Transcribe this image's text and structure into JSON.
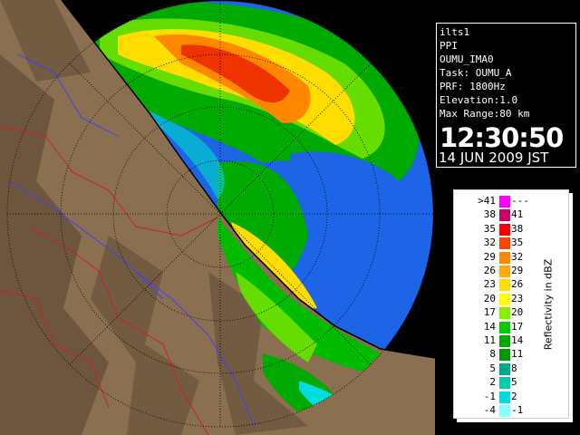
{
  "info": {
    "lines": [
      "ilts1",
      "PPI",
      "OUMU_IMA0",
      "Task: OUMU_A",
      "PRF: 1800Hz",
      "Elevation:1.0",
      "Max Range:80 km"
    ],
    "time": "12:30:50",
    "date": "14 JUN 2009 JST"
  },
  "legend": {
    "title": "Reflectivity in dBZ",
    "rows": [
      {
        "lo": ">41",
        "hi": "---",
        "color": "#ff00ff"
      },
      {
        "lo": "38",
        "hi": "41",
        "color": "#cc0066"
      },
      {
        "lo": "35",
        "hi": "38",
        "color": "#ff0000"
      },
      {
        "lo": "32",
        "hi": "35",
        "color": "#ff4400"
      },
      {
        "lo": "29",
        "hi": "32",
        "color": "#ff8800"
      },
      {
        "lo": "26",
        "hi": "29",
        "color": "#ffaa00"
      },
      {
        "lo": "23",
        "hi": "26",
        "color": "#ffdd00"
      },
      {
        "lo": "20",
        "hi": "23",
        "color": "#ffff00"
      },
      {
        "lo": "17",
        "hi": "20",
        "color": "#88ee00"
      },
      {
        "lo": "14",
        "hi": "17",
        "color": "#00cc00"
      },
      {
        "lo": "11",
        "hi": "14",
        "color": "#00aa00"
      },
      {
        "lo": "8",
        "hi": "11",
        "color": "#009900"
      },
      {
        "lo": "5",
        "hi": "8",
        "color": "#00aa88"
      },
      {
        "lo": "2",
        "hi": "5",
        "color": "#00ccaa"
      },
      {
        "lo": "-1",
        "hi": "2",
        "color": "#00dddd"
      },
      {
        "lo": "-4",
        "hi": "-1",
        "color": "#88ffff"
      }
    ]
  },
  "map": {
    "colors": {
      "echo_base": "#1e64e6",
      "land": "#8a7050",
      "land_dark": "#5a4530",
      "coast": "#000000",
      "boundary_red": "#cc2222",
      "boundary_blue": "#4040ff",
      "range_ring": "#000000"
    }
  }
}
